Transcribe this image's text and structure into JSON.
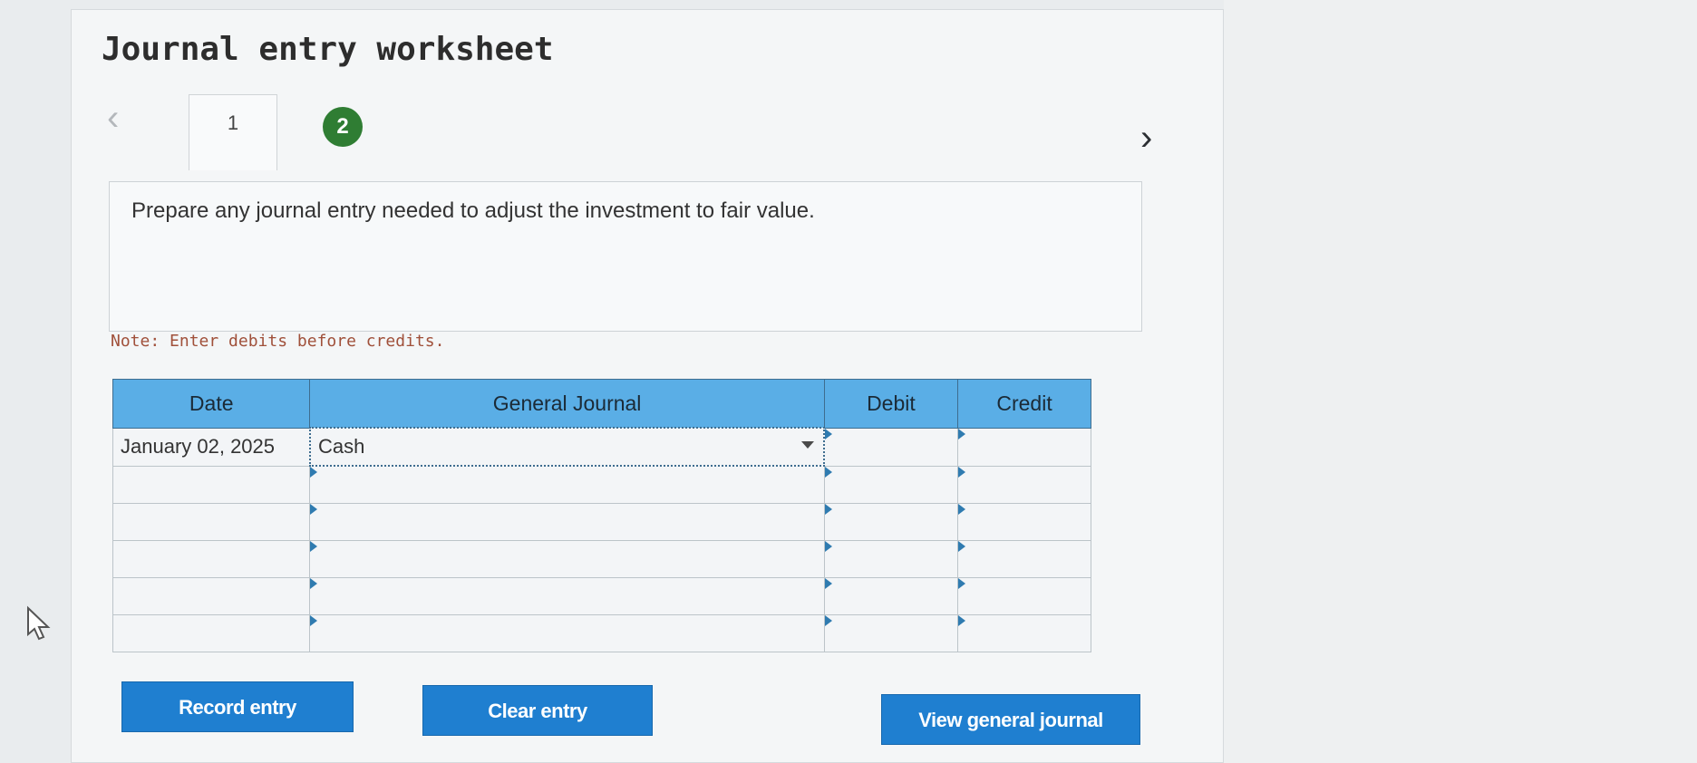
{
  "worksheet": {
    "title": "Journal entry worksheet",
    "tabs": [
      {
        "label": "1"
      },
      {
        "label": "2"
      }
    ],
    "prompt": "Prepare any journal entry needed to adjust the investment to fair value.",
    "note": "Note: Enter debits before credits."
  },
  "table": {
    "headers": {
      "date": "Date",
      "journal": "General Journal",
      "debit": "Debit",
      "credit": "Credit"
    },
    "rows": [
      {
        "date": "January 02, 2025",
        "account": "Cash",
        "debit": "",
        "credit": ""
      },
      {
        "date": "",
        "account": "",
        "debit": "",
        "credit": ""
      },
      {
        "date": "",
        "account": "",
        "debit": "",
        "credit": ""
      },
      {
        "date": "",
        "account": "",
        "debit": "",
        "credit": ""
      },
      {
        "date": "",
        "account": "",
        "debit": "",
        "credit": ""
      },
      {
        "date": "",
        "account": "",
        "debit": "",
        "credit": ""
      }
    ]
  },
  "buttons": {
    "record": "Record entry",
    "clear": "Clear entry",
    "view": "View general journal"
  },
  "icons": {
    "prev": "chevron-left-icon",
    "next": "chevron-right-icon",
    "dropdown": "caret-down-icon",
    "cursor": "mouse-pointer-icon"
  },
  "colors": {
    "header_blue": "#5aaee6",
    "button_blue": "#1f7fd0",
    "active_tab_green": "#2f7d33",
    "note_red": "#a0503a"
  }
}
